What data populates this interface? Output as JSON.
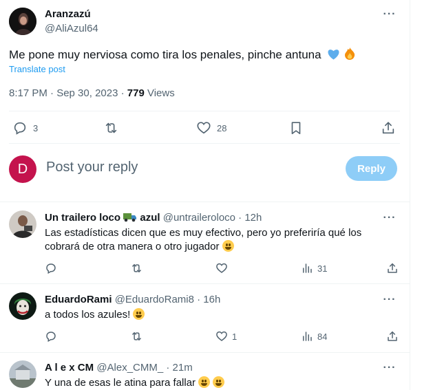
{
  "post": {
    "author_name": "Aranzazú",
    "author_handle": "@AliAzul64",
    "text": "Me pone muy nerviosa como tira los penales, pinche antuna",
    "translate_label": "Translate post",
    "time": "8:17 PM · Sep 30, 2023 · ",
    "views_count": "779",
    "views_label": " Views",
    "replies": "3",
    "likes": "28"
  },
  "composer": {
    "avatar_letter": "D",
    "placeholder": "Post your reply",
    "reply_label": "Reply",
    "avatar_color": "#c4134d"
  },
  "replies": [
    {
      "name": "Un trailero loco",
      "name_suffix": " azul",
      "handle": "@untraileroloco · 12h",
      "text": "Las estadísticas dicen que es muy efectivo, pero yo preferiría qué los cobrará de otra manera o otro jugador",
      "replies": "",
      "reposts": "",
      "likes": "",
      "views": "31"
    },
    {
      "name": "EduardoRami",
      "handle": "@EduardoRami8 · 16h",
      "text": "a todos los azules!",
      "replies": "",
      "reposts": "",
      "likes": "1",
      "views": "84"
    },
    {
      "name": "A l e x CM",
      "handle": "@Alex_CMM_ · 21m",
      "text": "Y una de esas le atina para fallar"
    }
  ],
  "colors": {
    "accent": "#1d9bf0",
    "muted": "#536471",
    "reply_button": "#8ecdf7",
    "heart_emoji": "#5dadec"
  }
}
